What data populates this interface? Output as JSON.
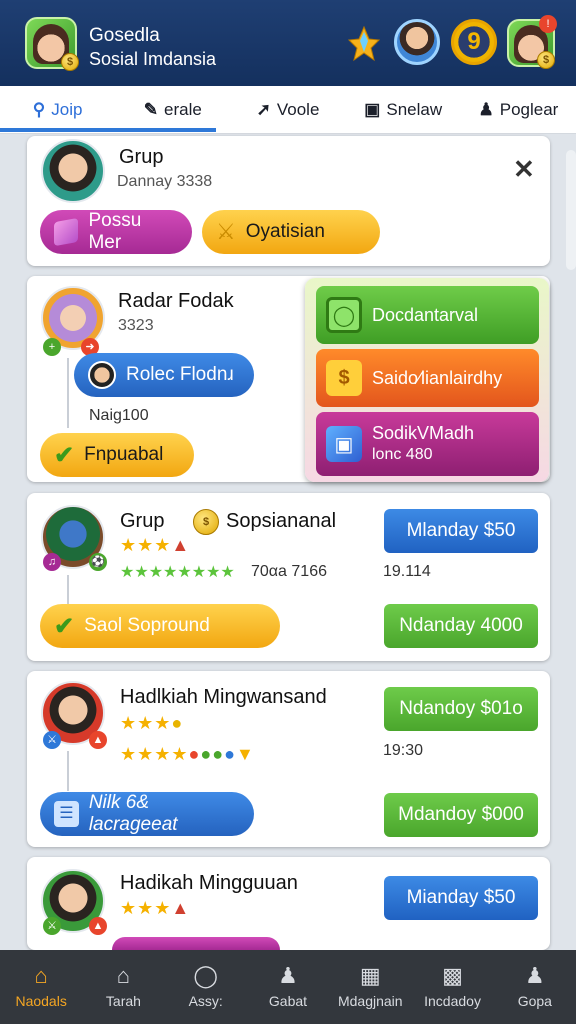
{
  "header": {
    "title": "Gosedla",
    "subtitle": "Sosial Imdansia",
    "level_badge": "9"
  },
  "tabs": [
    {
      "label": "Joip",
      "icon": "search-icon",
      "active": true
    },
    {
      "label": "erale",
      "icon": "edit-icon",
      "active": false
    },
    {
      "label": "Voole",
      "icon": "chart-icon",
      "active": false
    },
    {
      "label": "Snelaw",
      "icon": "window-icon",
      "active": false
    },
    {
      "label": "Poglear",
      "icon": "person-icon",
      "active": false
    }
  ],
  "cards": {
    "c1": {
      "name": "Grup",
      "sub": "Dannay 3338",
      "pill1": "Possu Mer",
      "pill2": "Oyatisian"
    },
    "c2": {
      "name": "Radar Fodak",
      "sub": "3323",
      "pill1": "Rolec Flodnɹ",
      "note": "Naig100",
      "pill2": "Fnpuabal"
    },
    "c3": {
      "name": "Grup",
      "name2": "Sopsiananal",
      "rating": "70αa 7166",
      "amount": "19.114",
      "btn1": "Mlanday $50",
      "pill": "Saol Sopround",
      "btn2": "Ndanday 4000"
    },
    "c4": {
      "name": "Hadlkiah Mingwansand",
      "amount": "19:30",
      "btn1": "Ndandoy $01o",
      "pill": "Nilk 6& lacrageeat",
      "btn2": "Mdandoy $000"
    },
    "c5": {
      "name": "Hadikah Mingguuan",
      "btn1": "Mianday $50"
    }
  },
  "popup": {
    "item1": "Docdantarval",
    "item2": "Saido∕lianlairdhy",
    "item3_line1": "SodikVMadh",
    "item3_line2": "lonc 480"
  },
  "bottom_nav": [
    {
      "label": "Naodals",
      "icon": "home-icon",
      "active": true
    },
    {
      "label": "Tarah",
      "icon": "house-icon",
      "active": false
    },
    {
      "label": "Assy:",
      "icon": "profile-icon",
      "active": false
    },
    {
      "label": "Gabat",
      "icon": "people-icon",
      "active": false
    },
    {
      "label": "Mdagjnain",
      "icon": "grid-icon",
      "active": false
    },
    {
      "label": "Incdadoy",
      "icon": "image-icon",
      "active": false
    },
    {
      "label": "Gopa",
      "icon": "user-icon",
      "active": false
    }
  ],
  "colors": {
    "header": "#1f3f73",
    "accent": "#2e78d8",
    "green": "#4aa62c",
    "yellow": "#f2a711",
    "magenta": "#a62a94"
  }
}
